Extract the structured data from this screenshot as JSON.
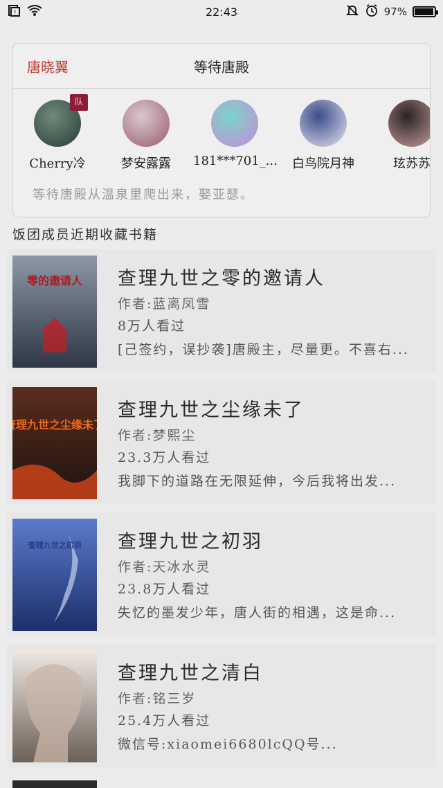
{
  "status_bar": {
    "time": "22:43",
    "battery_text": "97%",
    "battery_level": 0.97
  },
  "team": {
    "name": "唐晓翼",
    "leader": "等待唐殿",
    "badge": "队",
    "description": "等待唐殿从温泉里爬出来，娶亚瑟。",
    "members": [
      {
        "name": "Cherry冷",
        "colors": [
          "#6f8a7c",
          "#2b3b35"
        ]
      },
      {
        "name": "梦安露露",
        "colors": [
          "#d9c9cf",
          "#9b5a6b"
        ]
      },
      {
        "name": "181***701_...",
        "colors": [
          "#7ad4c8",
          "#c98bd9"
        ]
      },
      {
        "name": "白鸟院月神",
        "colors": [
          "#3b4b8c",
          "#e6e6f0"
        ]
      },
      {
        "name": "玹苏苏",
        "colors": [
          "#2a2325",
          "#c9a09a"
        ]
      }
    ]
  },
  "section_title": "饭团成员近期收藏书籍",
  "books": [
    {
      "title": "查理九世之零的邀请人",
      "author": "作者:蓝离凤雪",
      "views": "8万人看过",
      "desc": "[己签约，误抄袭]唐殿主，尽量更。不喜右...",
      "cover_text": "零的邀请人",
      "cover_colors": [
        "#8d97a6",
        "#2d3644",
        "#c21d24"
      ]
    },
    {
      "title": "查理九世之尘缘未了",
      "author": "作者:梦熙尘",
      "views": "23.3万人看过",
      "desc": "我脚下的道路在无限延伸，今后我将出发...",
      "cover_text": "查理九世之尘缘未了",
      "cover_colors": [
        "#5a2d1c",
        "#1f1310",
        "#e14a1a"
      ]
    },
    {
      "title": "查理九世之初羽",
      "author": "作者:天冰水灵",
      "views": "23.8万人看过",
      "desc": "失忆的墨发少年，唐人街的相遇，这是命...",
      "cover_text": "查理九世之初羽",
      "cover_colors": [
        "#5b7bc9",
        "#1c2f6b",
        "#b9c9e9"
      ]
    },
    {
      "title": "查理九世之清白",
      "author": "作者:铭三岁",
      "views": "25.4万人看过",
      "desc": "微信号:xiaomei6680lcQQ号...",
      "cover_text": "",
      "cover_colors": [
        "#efe9e3",
        "#6b5f57",
        "#c9b7a8"
      ]
    }
  ]
}
